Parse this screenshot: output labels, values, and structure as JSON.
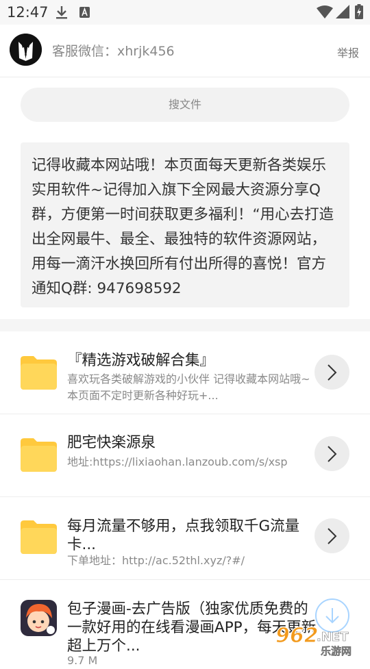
{
  "status_bar": {
    "time": "12:47",
    "icons": [
      "download-icon",
      "a-badge-icon",
      "wifi-icon",
      "signal-icon",
      "battery-charging-icon"
    ]
  },
  "header": {
    "contact": "客服微信：xhrjk456",
    "report": "举报",
    "avatar_icon": "tuxedo-avatar-icon"
  },
  "search": {
    "placeholder": "搜文件"
  },
  "notice": {
    "text": "记得收藏本网站哦！本页面每天更新各类娱乐实用软件~记得加入旗下全网最大资源分享Q群，方便第一时间获取更多福利！“用心去打造出全网最牛、最全、最独特的软件资源网站，用每一滴汗水换回所有付出所得的喜悦！官方通知Q群: 947698592"
  },
  "items": [
    {
      "title": "『精选游戏破解合集』",
      "subtitle": "喜欢玩各类破解游戏的小伙伴 记得收藏本网站哦~本页面不定时更新各种好玩+...",
      "icon": "folder-icon"
    },
    {
      "title": "肥宅快楽源泉",
      "subtitle": "地址:https://lixiaohan.lanzoub.com/s/xsp",
      "icon": "folder-icon"
    },
    {
      "title": "每月流量不够用，点我领取千G流量卡...",
      "subtitle": "下单地址：http://ac.52thl.xyz/?#/",
      "icon": "folder-icon"
    },
    {
      "title": "包子漫画-去广告版（独家优质免费的一款好用的在线看漫画APP，每天更新超上万个...",
      "subtitle": "9.7 M",
      "icon": "manga-app-icon"
    }
  ],
  "watermark": {
    "number": "962",
    "suffix": ".NET",
    "label": "乐游网"
  },
  "colors": {
    "folder": "#ffd75a",
    "folder_tab": "#ffc93d",
    "arrow_bg": "#ececec",
    "fab_border": "#a8d4ff",
    "watermark_orange": "#f29a1d"
  }
}
